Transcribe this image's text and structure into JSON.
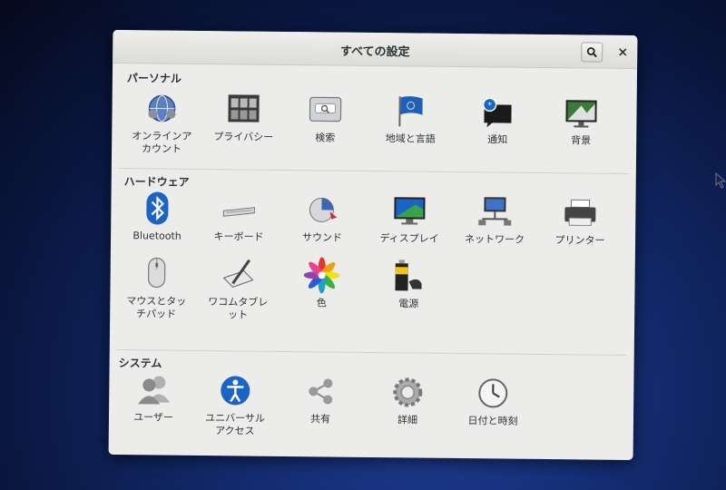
{
  "window": {
    "title": "すべての設定"
  },
  "sections": {
    "personal": {
      "title": "パーソナル",
      "items": [
        {
          "label": "オンラインア\nカウント",
          "icon": "online-accounts-icon"
        },
        {
          "label": "プライバシー",
          "icon": "privacy-icon"
        },
        {
          "label": "検索",
          "icon": "search-settings-icon"
        },
        {
          "label": "地域と言語",
          "icon": "region-language-icon"
        },
        {
          "label": "通知",
          "icon": "notifications-icon"
        },
        {
          "label": "背景",
          "icon": "background-icon"
        }
      ]
    },
    "hardware": {
      "title": "ハードウェア",
      "items": [
        {
          "label": "Bluetooth",
          "icon": "bluetooth-icon"
        },
        {
          "label": "キーボード",
          "icon": "keyboard-icon"
        },
        {
          "label": "サウンド",
          "icon": "sound-icon"
        },
        {
          "label": "ディスプレイ",
          "icon": "display-icon"
        },
        {
          "label": "ネットワーク",
          "icon": "network-icon"
        },
        {
          "label": "プリンター",
          "icon": "printer-icon"
        },
        {
          "label": "マウスとタッ\nチパッド",
          "icon": "mouse-touchpad-icon"
        },
        {
          "label": "ワコムタブレ\nット",
          "icon": "wacom-tablet-icon"
        },
        {
          "label": "色",
          "icon": "color-icon"
        },
        {
          "label": "電源",
          "icon": "power-icon"
        }
      ]
    },
    "system": {
      "title": "システム",
      "items": [
        {
          "label": "ユーザー",
          "icon": "users-icon"
        },
        {
          "label": "ユニバーサル\nアクセス",
          "icon": "universal-access-icon"
        },
        {
          "label": "共有",
          "icon": "sharing-icon"
        },
        {
          "label": "詳細",
          "icon": "details-icon"
        },
        {
          "label": "日付と時刻",
          "icon": "date-time-icon"
        }
      ]
    }
  },
  "colors": {
    "accent_blue": "#1c63c6",
    "window_bg": "#ececea",
    "desktop_blue": "#132b6e"
  }
}
